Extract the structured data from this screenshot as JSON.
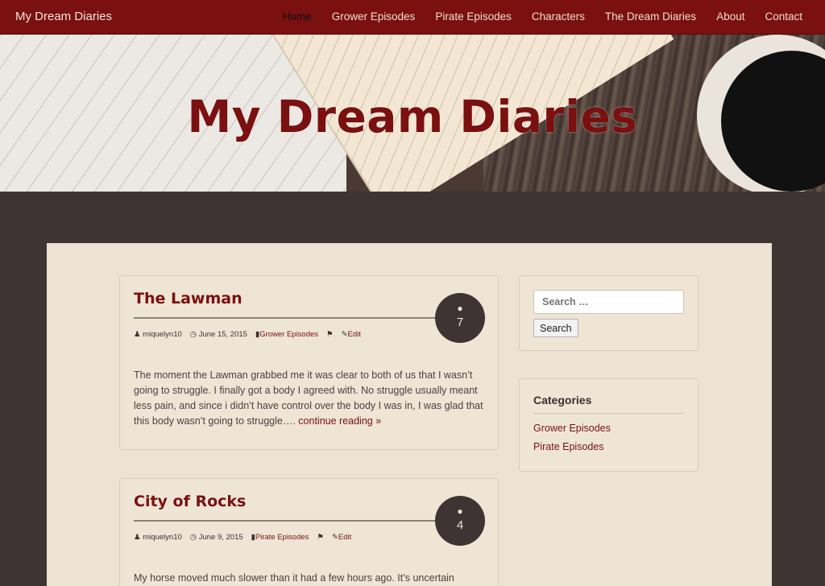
{
  "nav": {
    "brand": "My Dream Diaries",
    "items": [
      {
        "label": "Home",
        "active": true
      },
      {
        "label": "Grower Episodes"
      },
      {
        "label": "Pirate Episodes"
      },
      {
        "label": "Characters"
      },
      {
        "label": "The Dream Diaries"
      },
      {
        "label": "About"
      },
      {
        "label": "Contact"
      }
    ]
  },
  "hero": {
    "title": "My Dream Diaries"
  },
  "posts": [
    {
      "title": "The Lawman",
      "comments": "7",
      "author": "miquelyn10",
      "date": "June 15, 2015",
      "category": "Grower Episodes",
      "edit": "Edit",
      "excerpt": "The moment the Lawman grabbed me it was clear to both of us that I wasn’t going to struggle. I finally got a body I agreed with. No struggle usually meant less pain, and since i didn’t have control over the body I was in, I was glad that this body wasn’t going to struggle….",
      "more": "continue reading »"
    },
    {
      "title": "City of Rocks",
      "comments": "4",
      "author": "miquelyn10",
      "date": "June 9, 2015",
      "category": "Pirate Episodes",
      "edit": "Edit",
      "excerpt": "My horse moved much slower than it had a few hours ago. It’s uncertain"
    }
  ],
  "sidebar": {
    "search": {
      "placeholder": "Search …",
      "button": "Search"
    },
    "categories": {
      "title": "Categories",
      "items": [
        "Grower Episodes",
        "Pirate Episodes"
      ]
    }
  },
  "colors": {
    "brand": "#7a1010",
    "page_bg": "#3f3434",
    "content_bg": "#ece3d3"
  },
  "icons": [
    "comments-icon",
    "user-icon",
    "clock-icon",
    "folder-icon",
    "tags-icon",
    "pencil-icon"
  ]
}
